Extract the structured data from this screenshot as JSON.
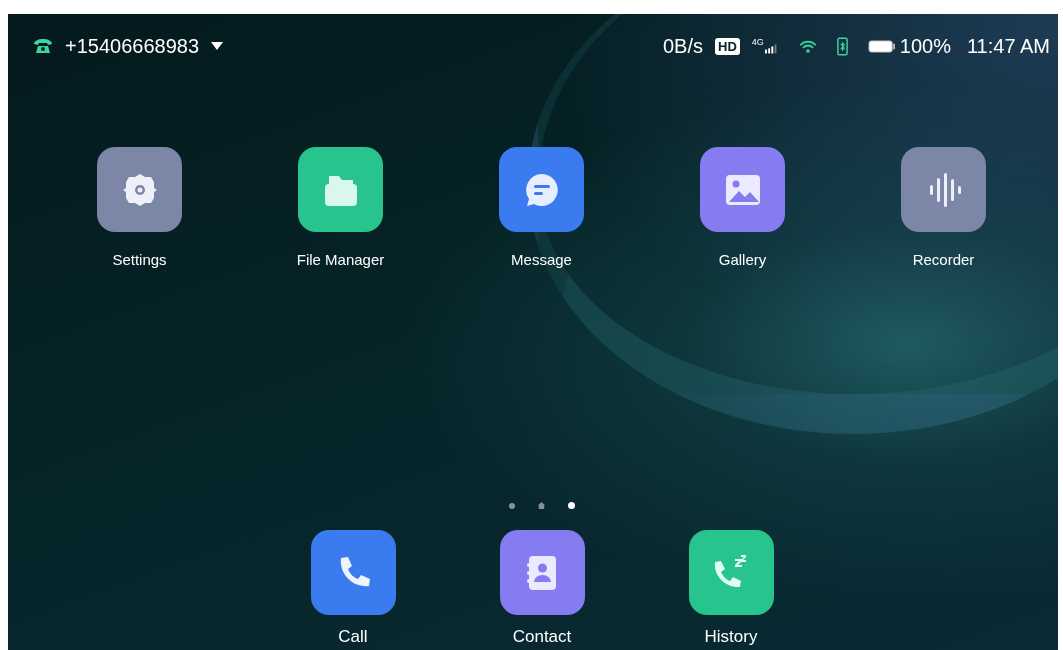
{
  "status_bar": {
    "phone_number": "+15406668983",
    "network_speed": "0B/s",
    "hd_badge": "HD",
    "network_type": "4G",
    "battery_percent": "100%",
    "time": "11:47 AM"
  },
  "apps": [
    {
      "label": "Settings",
      "kind": "settings",
      "color": "#7c86a6"
    },
    {
      "label": "File Manager",
      "kind": "folder",
      "color": "#27c48d"
    },
    {
      "label": "Message",
      "kind": "message",
      "color": "#3a7bef"
    },
    {
      "label": "Gallery",
      "kind": "gallery",
      "color": "#857cf2"
    },
    {
      "label": "Recorder",
      "kind": "recorder",
      "color": "#7c86a6"
    }
  ],
  "page_indicator": [
    {
      "kind": "dot",
      "selected": false
    },
    {
      "kind": "home",
      "selected": false
    },
    {
      "kind": "dot",
      "selected": true
    }
  ],
  "dock": [
    {
      "label": "Call",
      "kind": "call",
      "color": "#3a7bef"
    },
    {
      "label": "Contact",
      "kind": "contact",
      "color": "#857cf2"
    },
    {
      "label": "History",
      "kind": "history",
      "color": "#27c48d"
    }
  ]
}
